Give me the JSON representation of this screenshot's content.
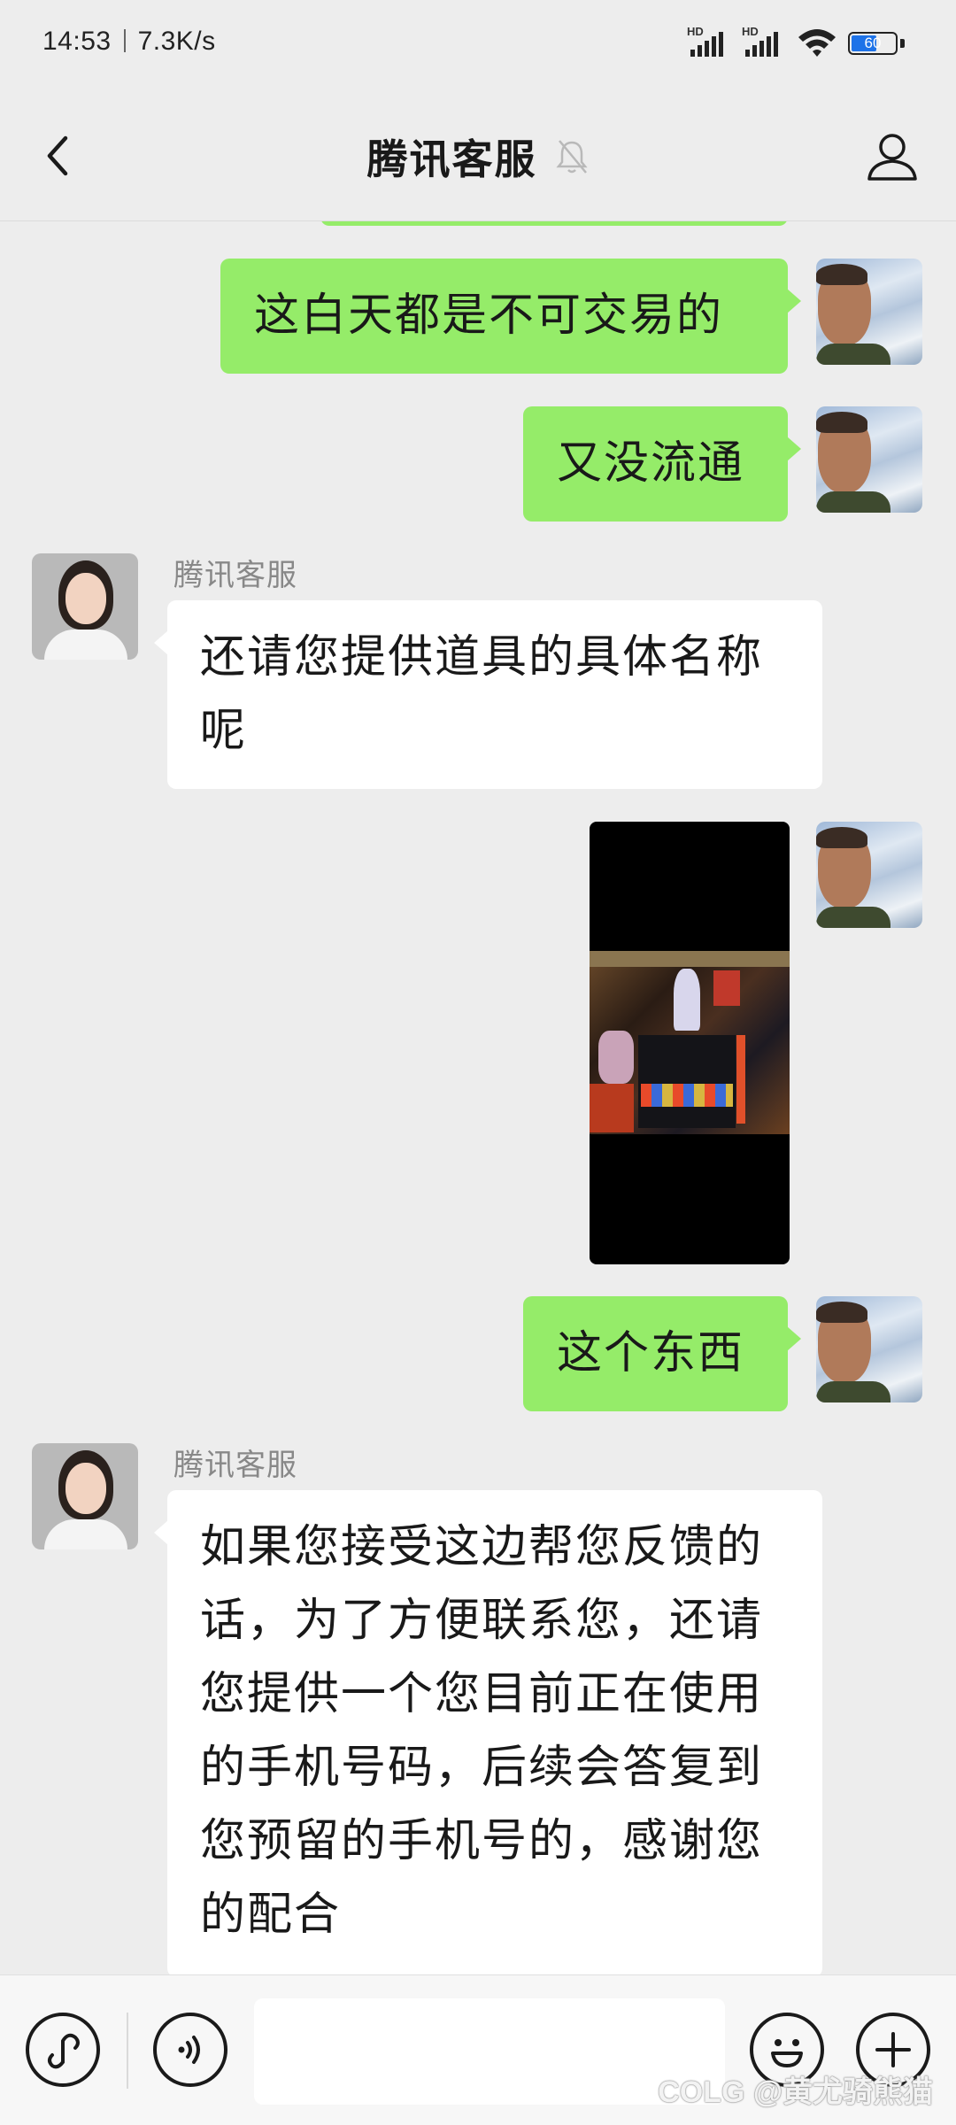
{
  "status_bar": {
    "time": "14:53",
    "net_speed": "7.3K/s",
    "sim1_label": "HD",
    "sim2_label": "HD",
    "battery_level": "60",
    "icons": [
      "signal-icon",
      "signal-icon",
      "wifi-icon",
      "battery-icon"
    ]
  },
  "header": {
    "title": "腾讯客服",
    "icons": [
      "back-arrow-icon",
      "mute-bell-icon",
      "profile-icon"
    ]
  },
  "messages": [
    {
      "side": "out",
      "type": "text",
      "text": "这白天都是不可交易的"
    },
    {
      "side": "out",
      "type": "text",
      "text": "又没流通"
    },
    {
      "side": "in",
      "type": "text",
      "sender": "腾讯客服",
      "lines": [
        "还请您提供道具的具体名称",
        "呢"
      ]
    },
    {
      "side": "out",
      "type": "image",
      "description": "game-screenshot"
    },
    {
      "side": "out",
      "type": "text",
      "text": "这个东西"
    },
    {
      "side": "in",
      "type": "text",
      "sender": "腾讯客服",
      "lines": [
        "如果您接受这边帮您反馈的",
        "话，为了方便联系您，还请",
        "您提供一个您目前正在使用",
        "的手机号码，后续会答复到",
        "您预留的手机号的，感谢您",
        "的配合"
      ]
    }
  ],
  "input_bar": {
    "icons": [
      "mini-program-icon",
      "voice-icon",
      "emoji-icon",
      "plus-icon"
    ],
    "text_value": ""
  },
  "watermark": "COLG @黄尤骑熊猫",
  "colors": {
    "background": "#ededed",
    "outgoing_bubble": "#95ec69",
    "incoming_bubble": "#ffffff",
    "sender_name": "#888888"
  }
}
